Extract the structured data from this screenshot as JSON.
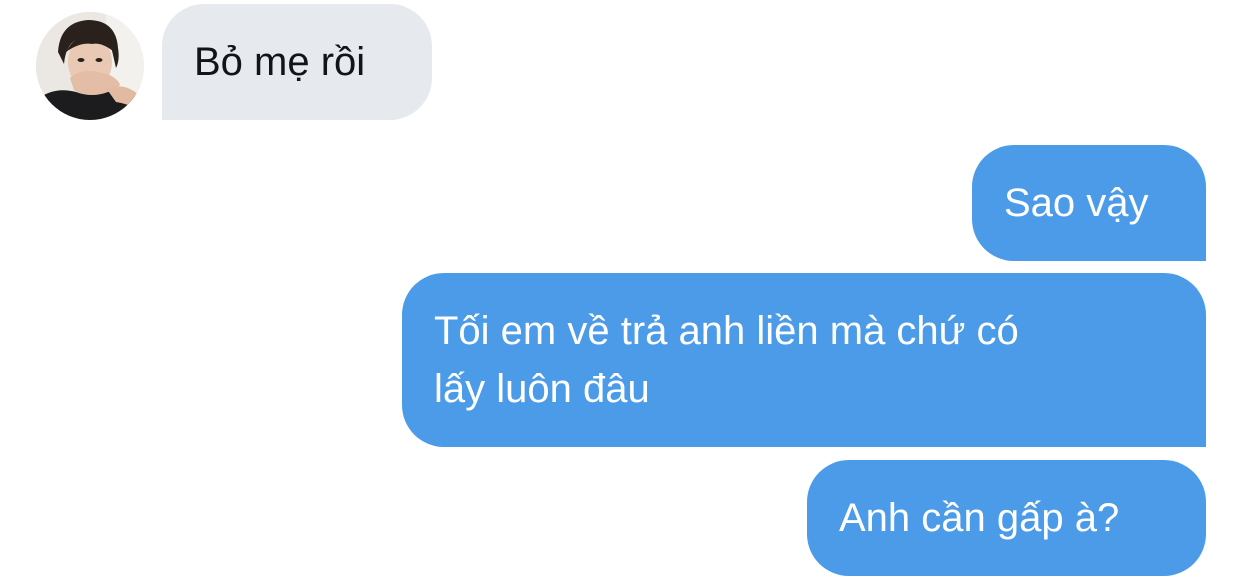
{
  "conversation": {
    "messages": [
      {
        "direction": "incoming",
        "text": "Bỏ mẹ rồi"
      },
      {
        "direction": "outgoing",
        "text": "Sao vậy"
      },
      {
        "direction": "outgoing",
        "text": "Tối em về trả anh liền mà chứ có\nlấy luôn đâu"
      },
      {
        "direction": "outgoing",
        "text": "Anh cần gấp à?"
      }
    ]
  },
  "colors": {
    "incoming_bubble": "#e6e9ee",
    "incoming_text": "#111418",
    "outgoing_bubble": "#4b9be8",
    "outgoing_text": "#ffffff",
    "background": "#ffffff"
  },
  "icons": {
    "avatar": "user-avatar-photo"
  }
}
